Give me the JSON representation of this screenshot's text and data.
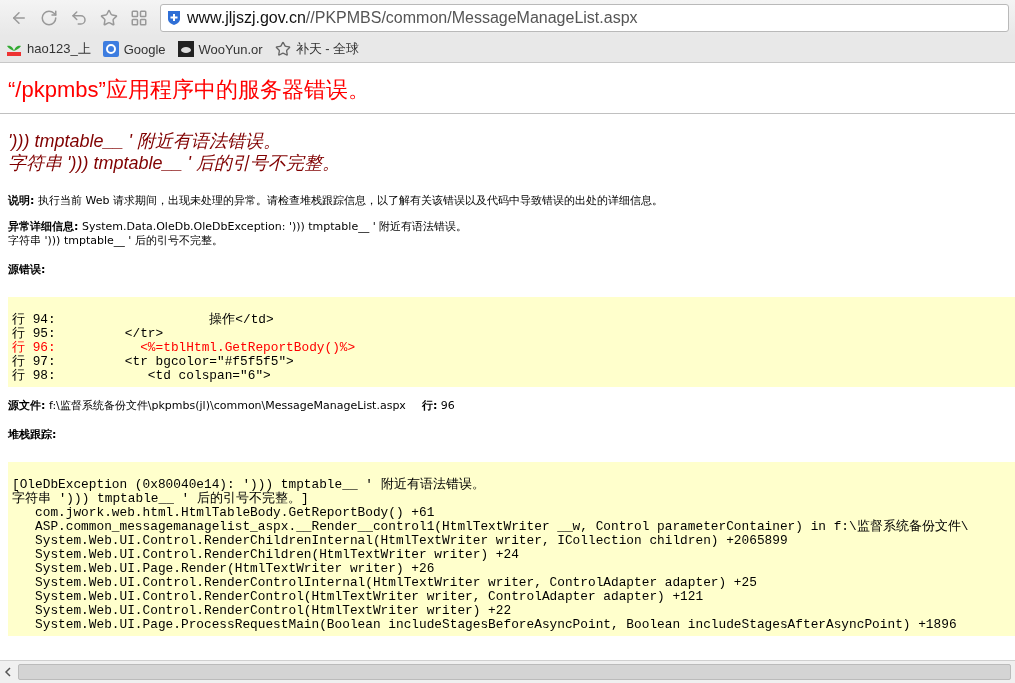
{
  "browser": {
    "address": {
      "host": "www.jljszj.gov.cn",
      "path": "//PKPMBS/common/MessageManageList.aspx"
    },
    "bookmarks": [
      {
        "kind": "sprout",
        "label": "hao123_上"
      },
      {
        "kind": "google",
        "label": "Google"
      },
      {
        "kind": "cloud",
        "label": "WooYun.or"
      },
      {
        "kind": "star",
        "label": "补天 - 全球"
      }
    ]
  },
  "page": {
    "title": "“/pkpmbs”应用程序中的服务器错误。",
    "error_message": [
      "'))) tmptable__ ' 附近有语法错误。",
      "字符串 '))) tmptable__ ' 后的引号不完整。"
    ],
    "description": "**说明:** 执行当前 Web 请求期间，出现未处理的异常。请检查堆栈跟踪信息，以了解有关该错误以及代码中导致错误的出处的详细信息。",
    "exception_details": [
      "**异常详细信息:** System.Data.OleDb.OleDbException: '))) tmptable__ ' 附近有语法错误。",
      "字符串 '))) tmptable__ ' 后的引号不完整。"
    ],
    "source_error_heading": "源错误:",
    "source_lines": [
      {
        "text": "行 94:                    操作</td>",
        "error": false
      },
      {
        "text": "行 95:         </tr>",
        "error": false
      },
      {
        "text": "行 96:           <%=tblHtml.GetReportBody()%>",
        "error": true
      },
      {
        "text": "行 97:         <tr bgcolor=\"#f5f5f5\">",
        "error": false
      },
      {
        "text": "行 98:            <td colspan=\"6\">",
        "error": false
      }
    ],
    "source_file": {
      "label": "源文件:",
      "value": "f:\\监督系统备份文件\\pkpmbs(jl)\\common\\MessageManageList.aspx",
      "line_label": "行:",
      "line_value": "96"
    },
    "stack_heading": "堆栈跟踪:",
    "stack_lines": [
      "[OleDbException (0x80040e14): '))) tmptable__ ' 附近有语法错误。",
      "字符串 '))) tmptable__ ' 后的引号不完整。]",
      "   com.jwork.web.html.HtmlTableBody.GetReportBody() +61",
      "   ASP.common_messagemanagelist_aspx.__Render__control1(HtmlTextWriter __w, Control parameterContainer) in f:\\监督系统备份文件\\",
      "   System.Web.UI.Control.RenderChildrenInternal(HtmlTextWriter writer, ICollection children) +2065899",
      "   System.Web.UI.Control.RenderChildren(HtmlTextWriter writer) +24",
      "   System.Web.UI.Page.Render(HtmlTextWriter writer) +26",
      "   System.Web.UI.Control.RenderControlInternal(HtmlTextWriter writer, ControlAdapter adapter) +25",
      "   System.Web.UI.Control.RenderControl(HtmlTextWriter writer, ControlAdapter adapter) +121",
      "   System.Web.UI.Control.RenderControl(HtmlTextWriter writer) +22",
      "   System.Web.UI.Page.ProcessRequestMain(Boolean includeStagesBeforeAsyncPoint, Boolean includeStagesAfterAsyncPoint) +1896"
    ]
  }
}
